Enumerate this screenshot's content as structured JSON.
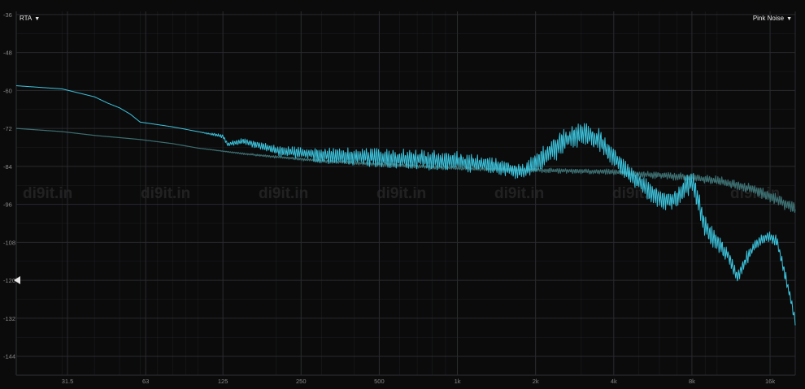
{
  "header": {
    "mode_label": "RTA",
    "source_label": "Pink Noise",
    "dropdown_glyph": "▼"
  },
  "watermark": "di9it.in",
  "colors": {
    "background": "#0b0b0c",
    "grid": "#2a2b2e",
    "axis_text": "#8a8a8a",
    "measured": "#3cc3dc",
    "reference": "#3c6e70"
  },
  "chart_data": {
    "type": "line",
    "x_scale": "log",
    "xlim": [
      20,
      20000
    ],
    "ylim": [
      -150,
      -35
    ],
    "y_ticks": [
      -36,
      -48,
      -60,
      -72,
      -84,
      -96,
      -108,
      -120,
      -132,
      -144
    ],
    "y_tick_labels": [
      "-36",
      "-48",
      "-60",
      "-72",
      "-84",
      "-96",
      "-108",
      "-120",
      "-132",
      "-144"
    ],
    "x_ticks": [
      31.5,
      63,
      125,
      250,
      500,
      1000,
      2000,
      4000,
      8000,
      16000
    ],
    "x_tick_labels": [
      "31.5",
      "63",
      "125",
      "250",
      "500",
      "1k",
      "2k",
      "4k",
      "8k",
      "16k"
    ],
    "grid": true,
    "reference_level": -120,
    "series": [
      {
        "x": [
          20,
          30,
          40,
          45,
          50,
          55,
          60,
          70,
          80,
          100,
          125,
          130,
          150,
          200,
          300,
          400,
          600,
          800,
          1000,
          1200,
          1500,
          1800,
          2000,
          2400,
          2700,
          3000,
          3500,
          4000,
          4500,
          5000,
          5500,
          6000,
          6500,
          7000,
          7500,
          8000,
          8500,
          9000,
          10000,
          11000,
          12000,
          13000,
          14000,
          15000,
          16000,
          17000,
          18000,
          19000,
          20000
        ],
        "y": [
          -58.5,
          -59.5,
          -62,
          -64,
          -65.5,
          -67.5,
          -70,
          -70.8,
          -71.5,
          -73,
          -74.5,
          -77,
          -76,
          -79,
          -80.5,
          -81,
          -81.5,
          -82,
          -82.5,
          -83,
          -84.5,
          -86,
          -83,
          -78,
          -75,
          -73.5,
          -75.5,
          -81,
          -86,
          -89,
          -92,
          -94,
          -95,
          -94,
          -91,
          -89,
          -95,
          -103,
          -108,
          -112,
          -119,
          -113,
          -109,
          -107,
          -106,
          -108,
          -116,
          -124,
          -133
        ],
        "wobble": [
          0,
          0,
          0,
          0,
          0,
          0,
          0,
          0,
          0,
          0,
          0.5,
          0.5,
          0.8,
          1.2,
          1.8,
          2.2,
          2.4,
          2.4,
          2.4,
          2.2,
          2,
          2,
          2.6,
          3,
          3,
          3,
          3,
          2.6,
          2.4,
          2.4,
          2.4,
          2.4,
          2.4,
          2.4,
          2.6,
          3,
          3,
          3,
          2.6,
          1.6,
          1.4,
          1.6,
          1.4,
          1.4,
          1.4,
          1.6,
          1.6,
          1.2,
          1
        ]
      },
      {
        "x": [
          20,
          30,
          40,
          60,
          80,
          100,
          150,
          200,
          300,
          500,
          700,
          1000,
          1500,
          2000,
          3000,
          4000,
          5000,
          6000,
          8000,
          10000,
          12000,
          14000,
          16000,
          18000,
          20000
        ],
        "y": [
          -72,
          -73,
          -74.2,
          -75.5,
          -76.8,
          -78.2,
          -80,
          -81,
          -82.3,
          -83.4,
          -84,
          -84.6,
          -85,
          -85.2,
          -85.5,
          -85.8,
          -86.4,
          -86.8,
          -87.5,
          -88.5,
          -90,
          -91.5,
          -93.5,
          -95.5,
          -97.5
        ],
        "wobble": [
          0,
          0,
          0,
          0,
          0,
          0,
          0.2,
          0.3,
          0.4,
          0.5,
          0.5,
          0.5,
          0.5,
          0.6,
          0.6,
          0.7,
          0.8,
          0.9,
          1,
          1.1,
          1.2,
          1.3,
          1.4,
          1.5,
          1.6
        ]
      }
    ]
  }
}
